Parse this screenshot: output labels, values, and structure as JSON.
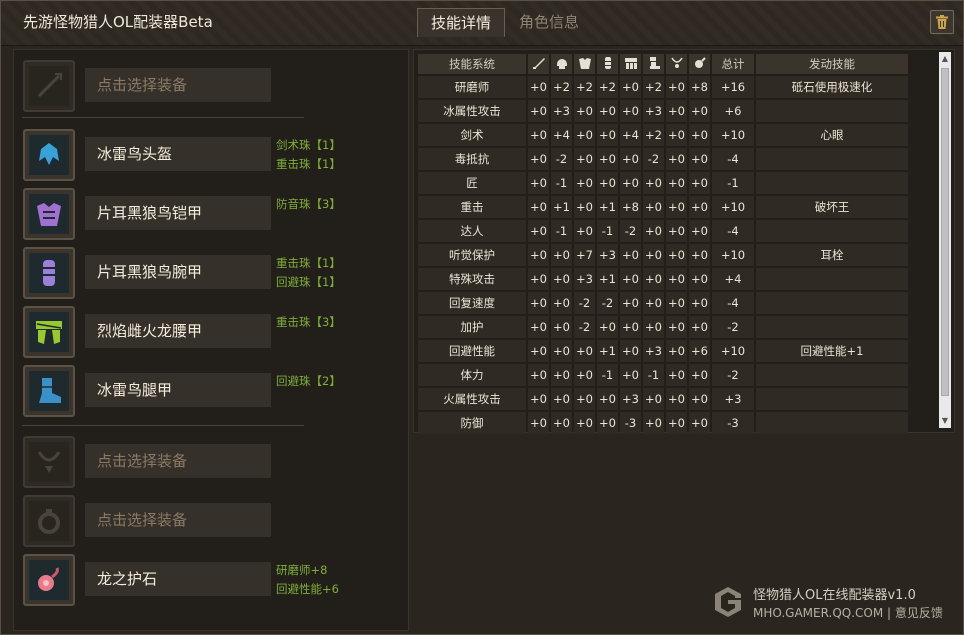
{
  "app": {
    "title": "先游怪物猎人OL配装器Beta"
  },
  "tabs": [
    {
      "label": "技能详情"
    },
    {
      "label": "角色信息"
    }
  ],
  "equipment": [
    {
      "name": "点击选择装备",
      "empty": true,
      "icon": "weapon-icon",
      "gems": []
    },
    {
      "name": "冰雷鸟头盔",
      "empty": false,
      "icon": "helmet-icon",
      "gems": [
        "剑术珠【1】",
        "重击珠【1】"
      ]
    },
    {
      "name": "片耳黑狼鸟铠甲",
      "empty": false,
      "icon": "chest-armor-icon",
      "gems": [
        "防音珠【3】"
      ]
    },
    {
      "name": "片耳黑狼鸟腕甲",
      "empty": false,
      "icon": "arm-armor-icon",
      "gems": [
        "重击珠【1】",
        "回避珠【1】"
      ]
    },
    {
      "name": "烈焰雌火龙腰甲",
      "empty": false,
      "icon": "waist-armor-icon",
      "gems": [
        "重击珠【3】"
      ]
    },
    {
      "name": "冰雷鸟腿甲",
      "empty": false,
      "icon": "leg-armor-icon",
      "gems": [
        "回避珠【2】"
      ]
    },
    {
      "name": "点击选择装备",
      "empty": true,
      "icon": "necklace-icon",
      "gems": []
    },
    {
      "name": "点击选择装备",
      "empty": true,
      "icon": "ring-icon",
      "gems": []
    },
    {
      "name": "龙之护石",
      "empty": false,
      "icon": "talisman-icon",
      "gems": [
        "研磨师+8",
        "回避性能+6"
      ]
    }
  ],
  "skills_table": {
    "headers": {
      "system": "技能系统",
      "total": "总计",
      "activated": "发动技能"
    },
    "column_icons": [
      "weapon-icon",
      "helmet-icon",
      "chest-icon",
      "arm-icon",
      "waist-icon",
      "leg-icon",
      "necklace-icon",
      "talisman-icon"
    ],
    "rows": [
      {
        "name": "研磨师",
        "values": [
          "+0",
          "+2",
          "+2",
          "+2",
          "+0",
          "+2",
          "+0",
          "+8"
        ],
        "total": "+16",
        "skill": "砥石使用极速化"
      },
      {
        "name": "冰属性攻击",
        "values": [
          "+0",
          "+3",
          "+0",
          "+0",
          "+0",
          "+3",
          "+0",
          "+0"
        ],
        "total": "+6",
        "skill": ""
      },
      {
        "name": "剑术",
        "values": [
          "+0",
          "+4",
          "+0",
          "+0",
          "+4",
          "+2",
          "+0",
          "+0"
        ],
        "total": "+10",
        "skill": "心眼"
      },
      {
        "name": "毒抵抗",
        "values": [
          "+0",
          "-2",
          "+0",
          "+0",
          "+0",
          "-2",
          "+0",
          "+0"
        ],
        "total": "-4",
        "skill": ""
      },
      {
        "name": "匠",
        "values": [
          "+0",
          "-1",
          "+0",
          "+0",
          "+0",
          "+0",
          "+0",
          "+0"
        ],
        "total": "-1",
        "skill": ""
      },
      {
        "name": "重击",
        "values": [
          "+0",
          "+1",
          "+0",
          "+1",
          "+8",
          "+0",
          "+0",
          "+0"
        ],
        "total": "+10",
        "skill": "破坏王"
      },
      {
        "name": "达人",
        "values": [
          "+0",
          "-1",
          "+0",
          "-1",
          "-2",
          "+0",
          "+0",
          "+0"
        ],
        "total": "-4",
        "skill": ""
      },
      {
        "name": "听觉保护",
        "values": [
          "+0",
          "+0",
          "+7",
          "+3",
          "+0",
          "+0",
          "+0",
          "+0"
        ],
        "total": "+10",
        "skill": "耳栓"
      },
      {
        "name": "特殊攻击",
        "values": [
          "+0",
          "+0",
          "+3",
          "+1",
          "+0",
          "+0",
          "+0",
          "+0"
        ],
        "total": "+4",
        "skill": ""
      },
      {
        "name": "回复速度",
        "values": [
          "+0",
          "+0",
          "-2",
          "-2",
          "+0",
          "+0",
          "+0",
          "+0"
        ],
        "total": "-4",
        "skill": ""
      },
      {
        "name": "加护",
        "values": [
          "+0",
          "+0",
          "-2",
          "+0",
          "+0",
          "+0",
          "+0",
          "+0"
        ],
        "total": "-2",
        "skill": ""
      },
      {
        "name": "回避性能",
        "values": [
          "+0",
          "+0",
          "+0",
          "+1",
          "+0",
          "+3",
          "+0",
          "+6"
        ],
        "total": "+10",
        "skill": "回避性能+1"
      },
      {
        "name": "体力",
        "values": [
          "+0",
          "+0",
          "+0",
          "-1",
          "+0",
          "-1",
          "+0",
          "+0"
        ],
        "total": "-2",
        "skill": ""
      },
      {
        "name": "火属性攻击",
        "values": [
          "+0",
          "+0",
          "+0",
          "+0",
          "+3",
          "+0",
          "+0",
          "+0"
        ],
        "total": "+3",
        "skill": ""
      },
      {
        "name": "防御",
        "values": [
          "+0",
          "+0",
          "+0",
          "+0",
          "-3",
          "+0",
          "+0",
          "+0"
        ],
        "total": "-3",
        "skill": ""
      }
    ]
  },
  "footer": {
    "line1": "怪物猎人OL在线配装器v1.0",
    "line2": "MHO.GAMER.QQ.COM | 意见反馈"
  },
  "colors": {
    "gem_text": "#7fae3a",
    "placeholder_text": "#8a7a64",
    "background": "#2b251f"
  }
}
